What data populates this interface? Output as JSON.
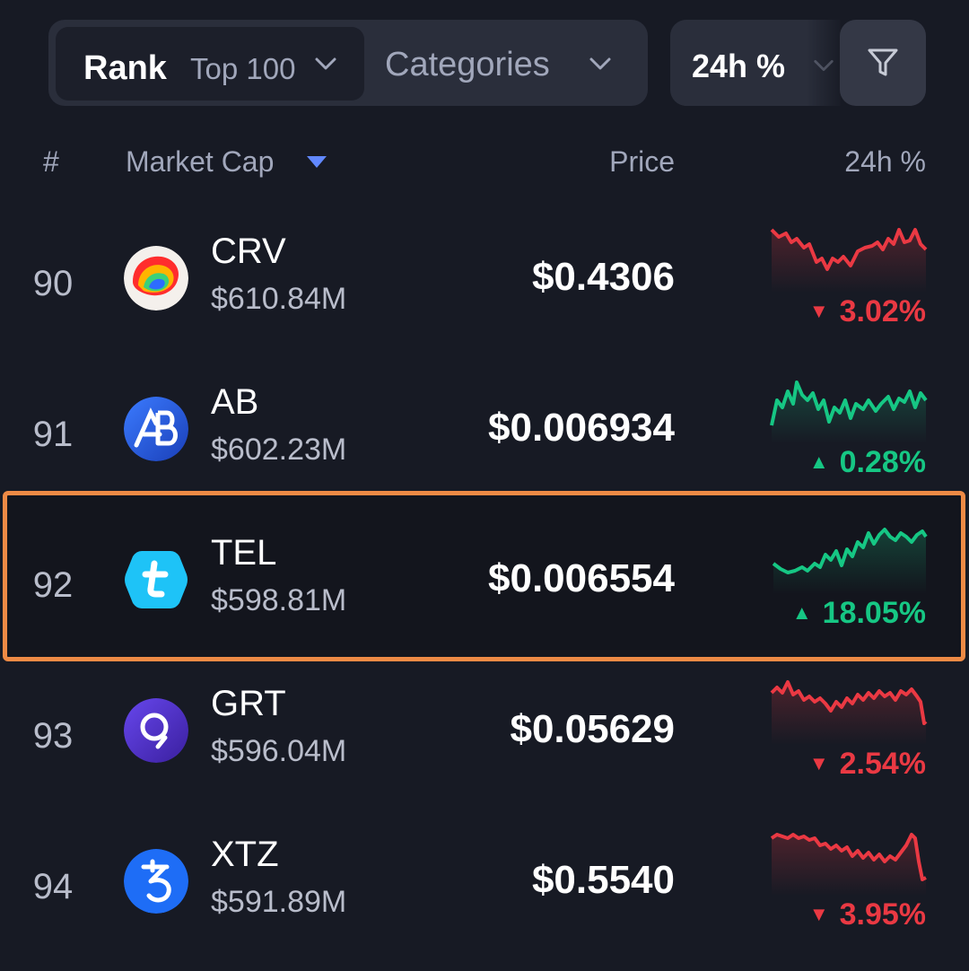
{
  "filters": {
    "rank_label": "Rank",
    "rank_value": "Top 100",
    "categories_label": "Categories",
    "timeframe_label": "24h %"
  },
  "columns": {
    "number": "#",
    "market_cap": "Market Cap",
    "price": "Price",
    "change": "24h %"
  },
  "colors": {
    "background": "#171a24",
    "negative": "#ea3943",
    "positive": "#16c784",
    "highlight_border": "#ee8a45",
    "sort_arrow": "#6188ff"
  },
  "rows": [
    {
      "rank": "90",
      "symbol": "CRV",
      "market_cap": "$610.84M",
      "price": "$0.4306",
      "change": "3.02%",
      "direction": "down",
      "icon": "curve-logo-icon"
    },
    {
      "rank": "91",
      "symbol": "AB",
      "market_cap": "$602.23M",
      "price": "$0.006934",
      "change": "0.28%",
      "direction": "up",
      "icon": "ab-logo-icon"
    },
    {
      "rank": "92",
      "symbol": "TEL",
      "market_cap": "$598.81M",
      "price": "$0.006554",
      "change": "18.05%",
      "direction": "up",
      "icon": "telcoin-logo-icon",
      "highlighted": true
    },
    {
      "rank": "93",
      "symbol": "GRT",
      "market_cap": "$596.04M",
      "price": "$0.05629",
      "change": "2.54%",
      "direction": "down",
      "icon": "graph-logo-icon"
    },
    {
      "rank": "94",
      "symbol": "XTZ",
      "market_cap": "$591.89M",
      "price": "$0.5540",
      "change": "3.95%",
      "direction": "down",
      "icon": "tezos-logo-icon"
    }
  ]
}
